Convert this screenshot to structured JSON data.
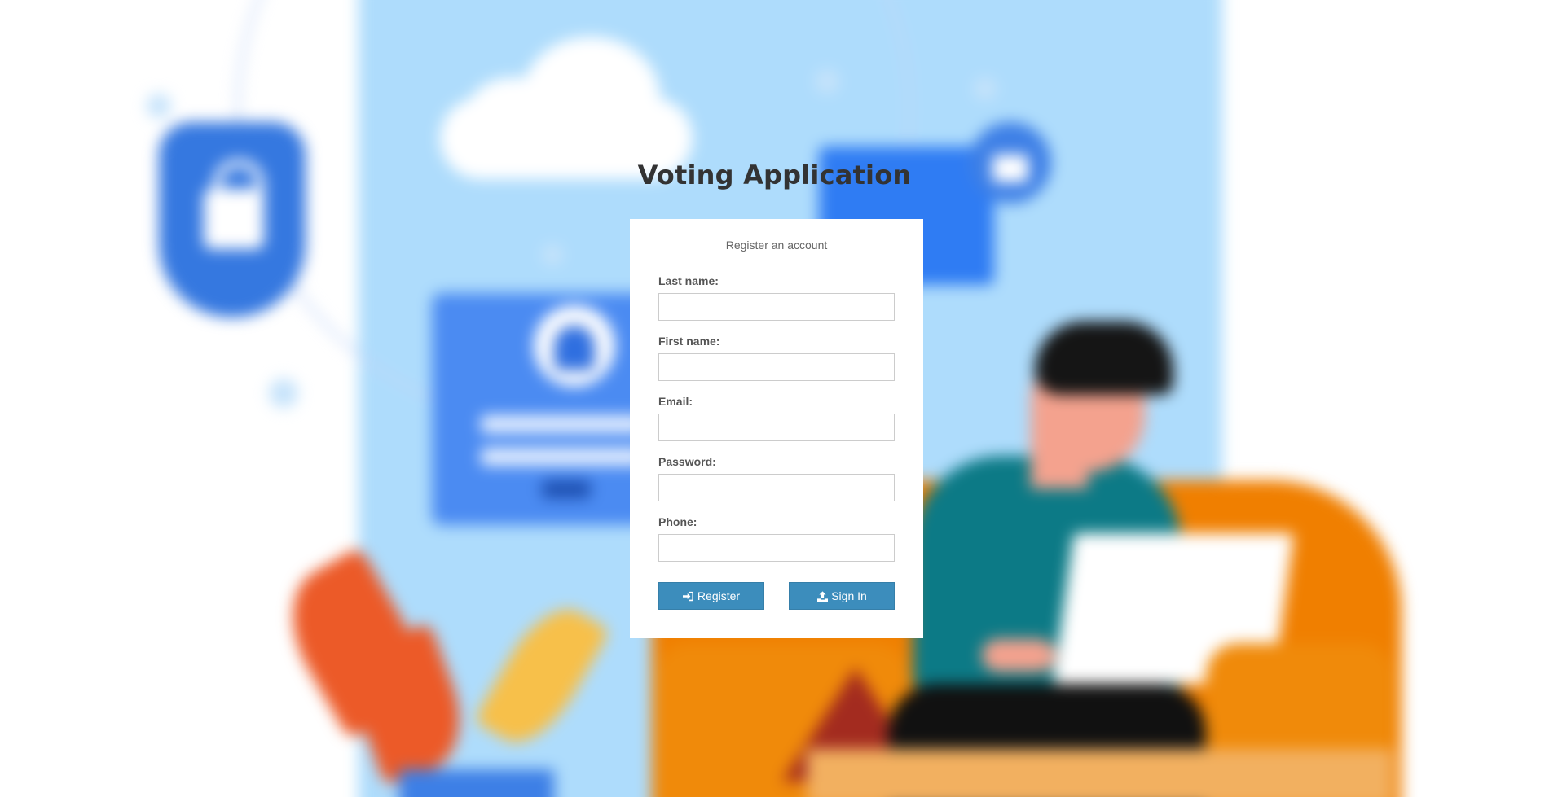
{
  "page": {
    "title": "Voting Application"
  },
  "register_box": {
    "message": "Register an account",
    "fields": [
      {
        "label": "Last name:",
        "value": "",
        "placeholder": ""
      },
      {
        "label": "First name:",
        "value": "",
        "placeholder": ""
      },
      {
        "label": "Email:",
        "value": "",
        "placeholder": ""
      },
      {
        "label": "Password:",
        "value": "",
        "placeholder": ""
      },
      {
        "label": "Phone:",
        "value": "",
        "placeholder": ""
      }
    ],
    "buttons": {
      "register": {
        "label": "Register",
        "icon": "sign-in-icon"
      },
      "sign_in": {
        "label": "Sign In",
        "icon": "upload-icon"
      }
    }
  },
  "colors": {
    "button_primary": "#3c8dbc",
    "title_text": "#333333",
    "background_panel": "#aedcfc"
  }
}
